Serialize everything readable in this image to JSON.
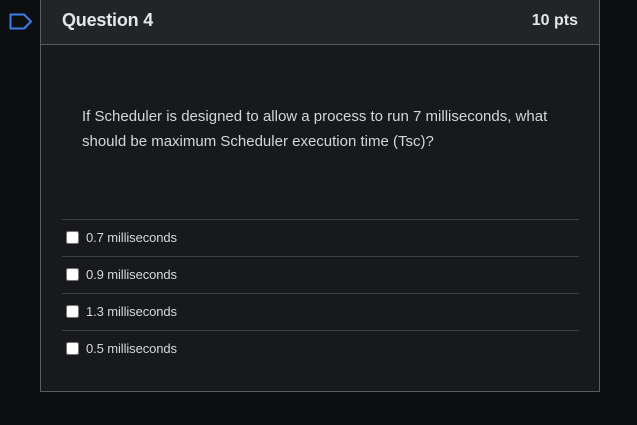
{
  "flag": {
    "icon": "flag-icon",
    "color": "#3b7ee8"
  },
  "question": {
    "title": "Question 4",
    "points": "10 pts",
    "text": "If Scheduler is designed to allow a process to run 7 milliseconds, what should be maximum Scheduler execution time (Tsc)?",
    "answers": [
      {
        "label": "0.7 milliseconds",
        "checked": false
      },
      {
        "label": "0.9 milliseconds",
        "checked": false
      },
      {
        "label": "1.3 milliseconds",
        "checked": false
      },
      {
        "label": "0.5 milliseconds",
        "checked": false
      }
    ]
  },
  "colors": {
    "background": "#0d0e10",
    "card": "#18191c",
    "header": "#232427",
    "border": "#595d63",
    "text": "#d5d8dc"
  }
}
